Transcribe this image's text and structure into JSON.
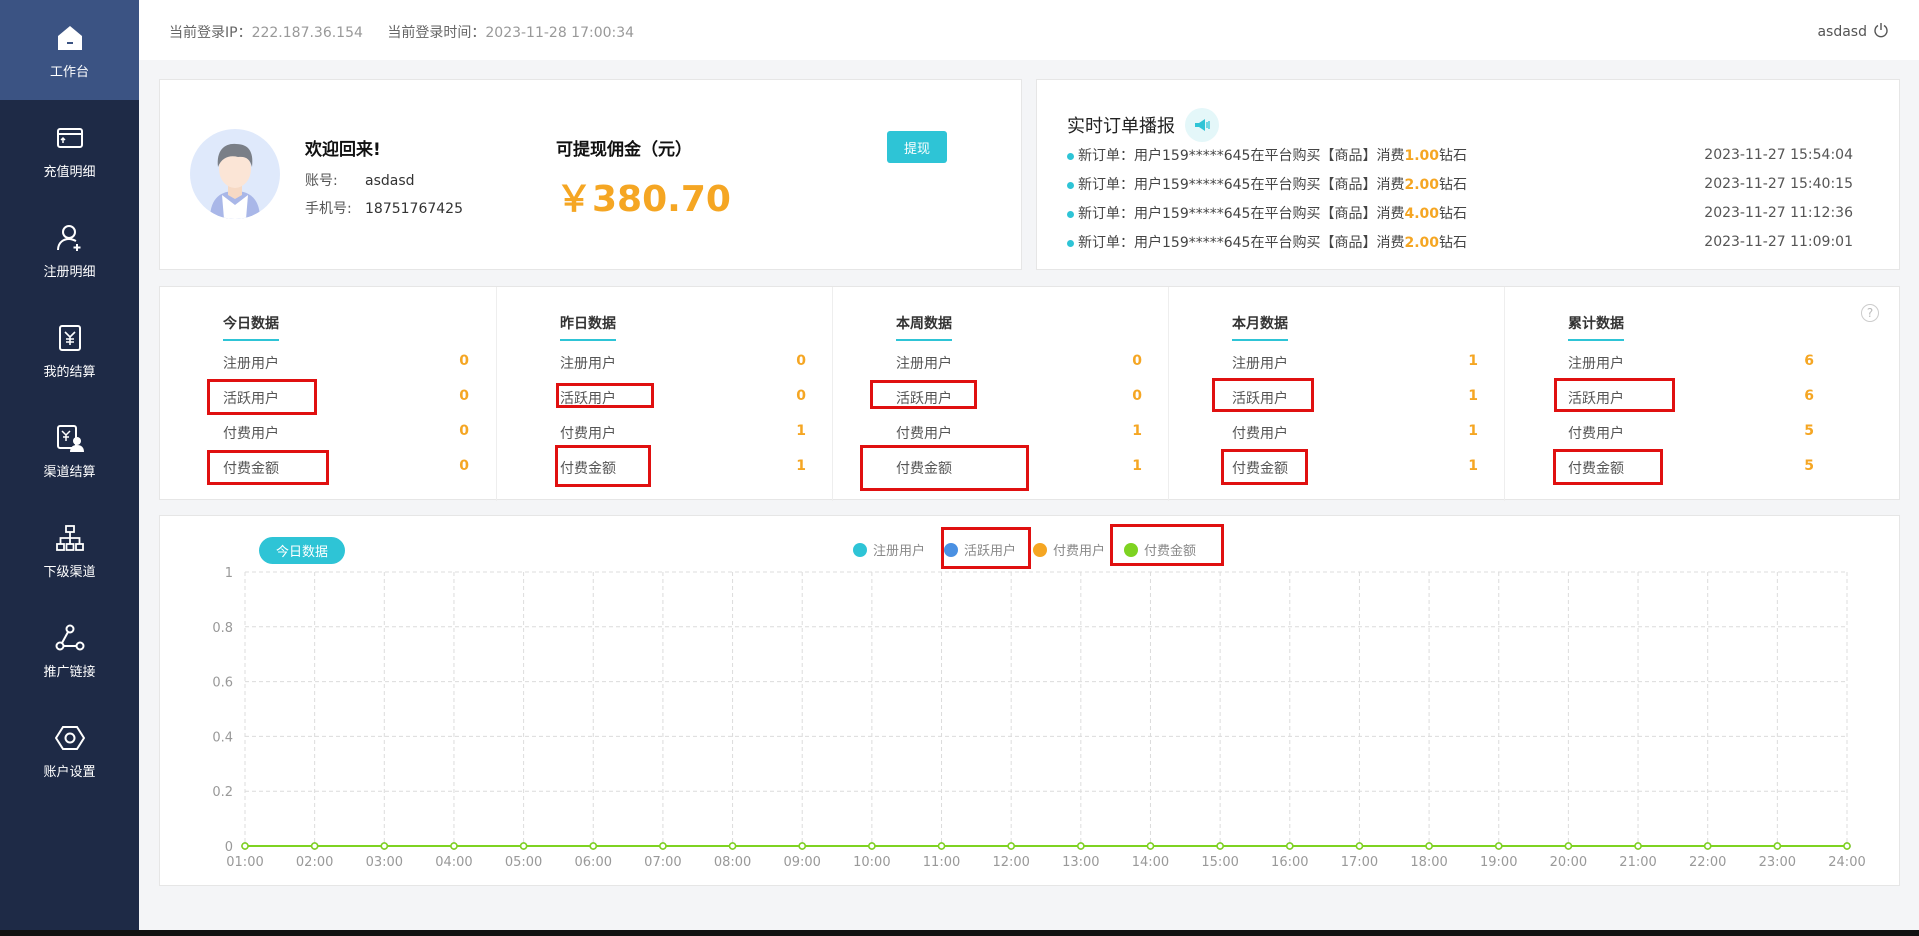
{
  "sidebar": {
    "items": [
      {
        "label": "工作台",
        "icon": "home-icon",
        "active": true
      },
      {
        "label": "充值明细",
        "icon": "card-icon"
      },
      {
        "label": "注册明细",
        "icon": "add-user-icon"
      },
      {
        "label": "我的结算",
        "icon": "yuan-doc-icon"
      },
      {
        "label": "渠道结算",
        "icon": "channel-settle-icon"
      },
      {
        "label": "下级渠道",
        "icon": "hierarchy-icon"
      },
      {
        "label": "推广链接",
        "icon": "share-icon"
      },
      {
        "label": "账户设置",
        "icon": "hexagon-settings-icon"
      }
    ]
  },
  "header": {
    "ip_label": "当前登录IP：",
    "ip_value": "222.187.36.154",
    "time_label": "当前登录时间：",
    "time_value": "2023-11-28 17:00:34",
    "username": "asdasd"
  },
  "welcome": {
    "title": "欢迎回来!",
    "account_label": "账号:",
    "account_value": "asdasd",
    "phone_label": "手机号:",
    "phone_value": "18751767425",
    "commission_title": "可提现佣金（元）",
    "commission_value": "￥380.70",
    "withdraw_label": "提现"
  },
  "orders": {
    "title": "实时订单播报",
    "items": [
      {
        "prefix": "新订单：用户159*****645在平台购买【商品】消费",
        "amount": "1.00",
        "suffix": "钻石",
        "time": "2023-11-27 15:54:04"
      },
      {
        "prefix": "新订单：用户159*****645在平台购买【商品】消费",
        "amount": "2.00",
        "suffix": "钻石",
        "time": "2023-11-27 15:40:15"
      },
      {
        "prefix": "新订单：用户159*****645在平台购买【商品】消费",
        "amount": "4.00",
        "suffix": "钻石",
        "time": "2023-11-27 11:12:36"
      },
      {
        "prefix": "新订单：用户159*****645在平台购买【商品】消费",
        "amount": "2.00",
        "suffix": "钻石",
        "time": "2023-11-27 11:09:01"
      }
    ]
  },
  "stats": {
    "columns": [
      {
        "title": "今日数据",
        "rows": [
          {
            "label": "注册用户",
            "value": "0"
          },
          {
            "label": "活跃用户",
            "value": "0"
          },
          {
            "label": "付费用户",
            "value": "0"
          },
          {
            "label": "付费金额",
            "value": "0"
          }
        ]
      },
      {
        "title": "昨日数据",
        "rows": [
          {
            "label": "注册用户",
            "value": "0"
          },
          {
            "label": "活跃用户",
            "value": "0"
          },
          {
            "label": "付费用户",
            "value": "1"
          },
          {
            "label": "付费金额",
            "value": "1"
          }
        ]
      },
      {
        "title": "本周数据",
        "rows": [
          {
            "label": "注册用户",
            "value": "0"
          },
          {
            "label": "活跃用户",
            "value": "0"
          },
          {
            "label": "付费用户",
            "value": "1"
          },
          {
            "label": "付费金额",
            "value": "1"
          }
        ]
      },
      {
        "title": "本月数据",
        "rows": [
          {
            "label": "注册用户",
            "value": "1"
          },
          {
            "label": "活跃用户",
            "value": "1"
          },
          {
            "label": "付费用户",
            "value": "1"
          },
          {
            "label": "付费金额",
            "value": "1"
          }
        ]
      },
      {
        "title": "累计数据",
        "rows": [
          {
            "label": "注册用户",
            "value": "6"
          },
          {
            "label": "活跃用户",
            "value": "6"
          },
          {
            "label": "付费用户",
            "value": "5"
          },
          {
            "label": "付费金额",
            "value": "5"
          }
        ]
      }
    ],
    "help": "?"
  },
  "chart_tab": "今日数据",
  "colors": {
    "accent": "#2ec4d6",
    "amount": "#f5a623",
    "sidebar": "#1e2a46",
    "sidebar_active": "#3b5383",
    "annotation": "#e01010"
  },
  "chart_data": {
    "type": "line",
    "x": [
      "01:00",
      "02:00",
      "03:00",
      "04:00",
      "05:00",
      "06:00",
      "07:00",
      "08:00",
      "09:00",
      "10:00",
      "11:00",
      "12:00",
      "13:00",
      "14:00",
      "15:00",
      "16:00",
      "17:00",
      "18:00",
      "19:00",
      "20:00",
      "21:00",
      "22:00",
      "23:00",
      "24:00"
    ],
    "ylim": [
      0,
      1
    ],
    "yticks": [
      "0",
      "0.2",
      "0.4",
      "0.6",
      "0.8",
      "1"
    ],
    "grid": true,
    "legend_position": "top-center",
    "series": [
      {
        "name": "注册用户",
        "color": "#2ec4d6",
        "values": [
          0,
          0,
          0,
          0,
          0,
          0,
          0,
          0,
          0,
          0,
          0,
          0,
          0,
          0,
          0,
          0,
          0,
          0,
          0,
          0,
          0,
          0,
          0,
          0
        ]
      },
      {
        "name": "活跃用户",
        "color": "#4a90e2",
        "values": [
          0,
          0,
          0,
          0,
          0,
          0,
          0,
          0,
          0,
          0,
          0,
          0,
          0,
          0,
          0,
          0,
          0,
          0,
          0,
          0,
          0,
          0,
          0,
          0
        ]
      },
      {
        "name": "付费用户",
        "color": "#f5a623",
        "values": [
          0,
          0,
          0,
          0,
          0,
          0,
          0,
          0,
          0,
          0,
          0,
          0,
          0,
          0,
          0,
          0,
          0,
          0,
          0,
          0,
          0,
          0,
          0,
          0
        ]
      },
      {
        "name": "付费金额",
        "color": "#7ed321",
        "values": [
          0,
          0,
          0,
          0,
          0,
          0,
          0,
          0,
          0,
          0,
          0,
          0,
          0,
          0,
          0,
          0,
          0,
          0,
          0,
          0,
          0,
          0,
          0,
          0
        ]
      }
    ]
  }
}
